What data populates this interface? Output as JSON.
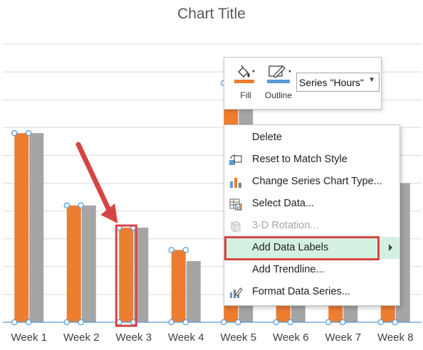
{
  "chart_data": {
    "type": "bar",
    "title": "Chart Title",
    "categories": [
      "Week 1",
      "Week 2",
      "Week 3",
      "Week 4",
      "Week 5",
      "Week 6",
      "Week 7",
      "Week 8"
    ],
    "series": [
      {
        "name": "Hours",
        "values": [
          68,
          42,
          34,
          26,
          86,
          42,
          32,
          56
        ]
      },
      {
        "values": [
          68,
          42,
          34,
          22,
          80,
          40,
          30,
          50
        ]
      }
    ],
    "ylim": [
      0,
      100
    ],
    "grid": true,
    "selected_series": "Hours",
    "colors": {
      "series_1": "#ED7D31",
      "series_2": "#A5A5A5",
      "gridline": "#D9D9D9",
      "axis": "#5B9BD5"
    }
  },
  "mini_toolbar": {
    "fill_label": "Fill",
    "outline_label": "Outline",
    "series_select_value": "Series \"Hours\"",
    "fill_color": "#ED7D31",
    "outline_color": "#5B9BD5"
  },
  "context_menu": {
    "items": [
      {
        "label": "Delete",
        "icon": "none",
        "enabled": true
      },
      {
        "label": "Reset to Match Style",
        "icon": "reset-style-icon",
        "enabled": true
      },
      {
        "label": "Change Series Chart Type...",
        "icon": "chart-type-icon",
        "enabled": true
      },
      {
        "label": "Select Data...",
        "icon": "select-data-icon",
        "enabled": true
      },
      {
        "label": "3-D Rotation...",
        "icon": "rotation-3d-icon",
        "enabled": false
      },
      {
        "label": "Add Data Labels",
        "icon": "none",
        "enabled": true,
        "highlighted": true,
        "submenu": true
      },
      {
        "label": "Add Trendline...",
        "icon": "none",
        "enabled": true
      },
      {
        "label": "Format Data Series...",
        "icon": "format-series-icon",
        "enabled": true
      }
    ],
    "highlight_color": "#D3F0E0"
  },
  "annotation": {
    "color": "#D64545"
  }
}
